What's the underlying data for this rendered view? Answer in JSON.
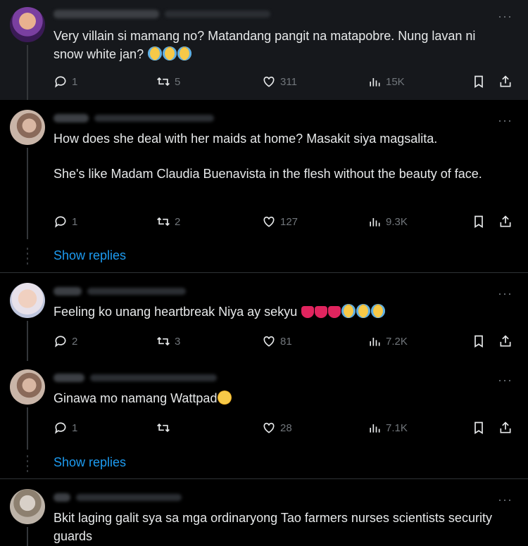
{
  "colors": {
    "background": "#000000",
    "highlight": "#16181c",
    "text": "#e7e9ea",
    "muted": "#71767b",
    "link": "#1d9bf0",
    "divider": "#2f3336"
  },
  "show_replies_label": "Show replies",
  "more_icon": "···",
  "posts": [
    {
      "text": [
        "Very villain si mamang no? Matandang pangit na  matapobre. Nung lavan ni snow white jan?"
      ],
      "emojis": [
        "loudly-crying",
        "loudly-crying",
        "loudly-crying"
      ],
      "replies": "1",
      "reposts": "5",
      "likes": "311",
      "views": "15K"
    },
    {
      "text": [
        "How does she deal with her maids at home? Masakit siya magsalita.",
        "She's like Madam Claudia Buenavista in the flesh without the beauty of face."
      ],
      "replies": "1",
      "reposts": "2",
      "likes": "127",
      "views": "9.3K"
    },
    {
      "text": [
        "Feeling ko unang heartbreak Niya ay sekyu"
      ],
      "emojis": [
        "broken-heart",
        "broken-heart",
        "broken-heart",
        "loudly-crying",
        "loudly-crying",
        "loudly-crying"
      ],
      "replies": "2",
      "reposts": "3",
      "likes": "81",
      "views": "7.2K"
    },
    {
      "text": [
        "Ginawa mo namang Wattpad"
      ],
      "emojis": [
        "rolling-laughing"
      ],
      "replies": "1",
      "reposts": "",
      "likes": "28",
      "views": "7.1K"
    },
    {
      "text": [
        "Bkit laging galit sya sa mga ordinaryong Tao farmers nurses scientists security guards"
      ]
    }
  ]
}
